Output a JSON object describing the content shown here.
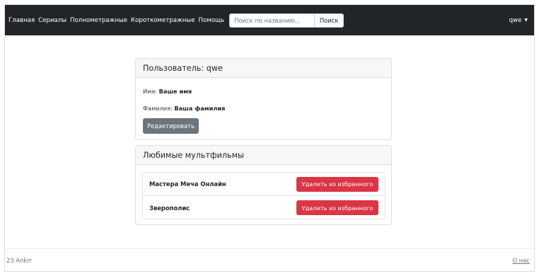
{
  "navbar": {
    "links": [
      "Главная",
      "Сериалы",
      "Полнометражные",
      "Короткометражные",
      "Помощь"
    ],
    "search_placeholder": "Поиск по названию...",
    "search_button": "Поиск",
    "user": "qwe"
  },
  "user_card": {
    "title": "Пользователь: qwe",
    "first_name_label": "Имя:",
    "first_name_value": "Ваше имя",
    "last_name_label": "Фамилия:",
    "last_name_value": "Ваша фамилия",
    "edit_button": "Редактировать"
  },
  "favorites_card": {
    "title": "Любимые мультфильмы",
    "items": [
      {
        "title": "Мастера Меча Онлайн",
        "button": "Удалить из избранного"
      },
      {
        "title": "Зверополис",
        "button": "Удалить из избранного"
      }
    ]
  },
  "footer": {
    "text": "23 Ankrr",
    "link": "О нас"
  },
  "colors": {
    "navbar_bg": "#212529",
    "secondary_button": "#6c757d",
    "danger_button": "#dc3545"
  }
}
